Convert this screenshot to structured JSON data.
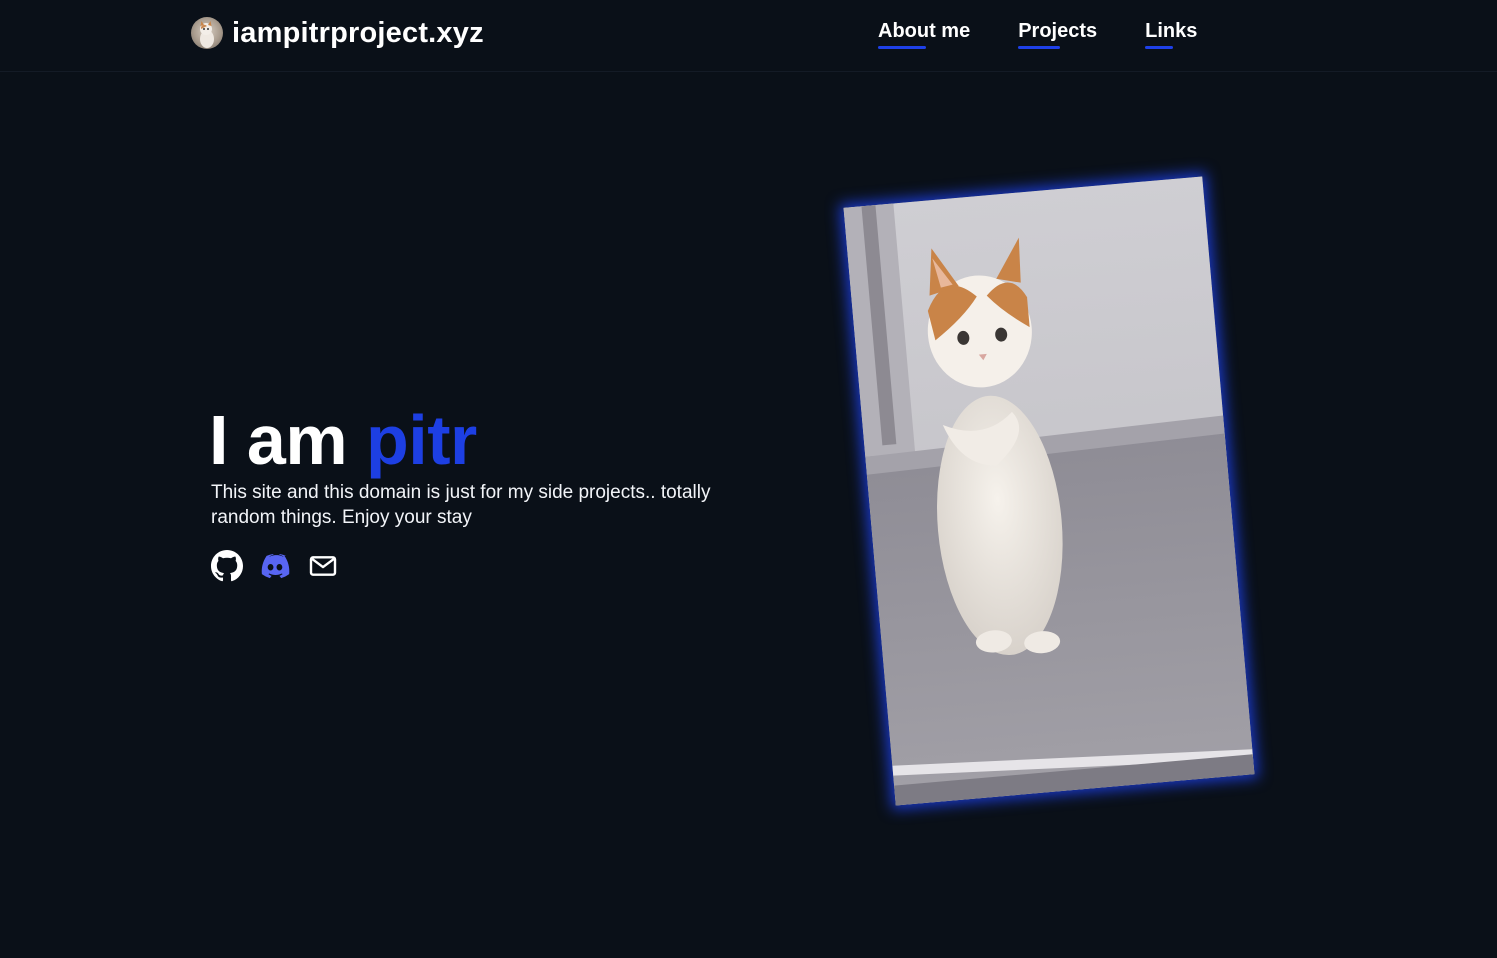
{
  "header": {
    "site_name": "iampitrproject.xyz",
    "avatar_icon": "cat-avatar-icon",
    "nav": [
      {
        "label": "About me"
      },
      {
        "label": "Projects"
      },
      {
        "label": "Links"
      }
    ]
  },
  "hero": {
    "title_prefix": "I am ",
    "title_name": "pitr",
    "subtitle": "This site and this domain is just for my side projects.. totally random things. Enjoy your stay",
    "socials": [
      {
        "icon": "github-icon"
      },
      {
        "icon": "discord-icon"
      },
      {
        "icon": "mail-icon"
      }
    ]
  },
  "colors": {
    "background": "#0a1018",
    "accent": "#1d3fe3",
    "discord": "#5865f2",
    "text": "#ffffff"
  },
  "image": {
    "subject": "dancing-cat-gif"
  }
}
